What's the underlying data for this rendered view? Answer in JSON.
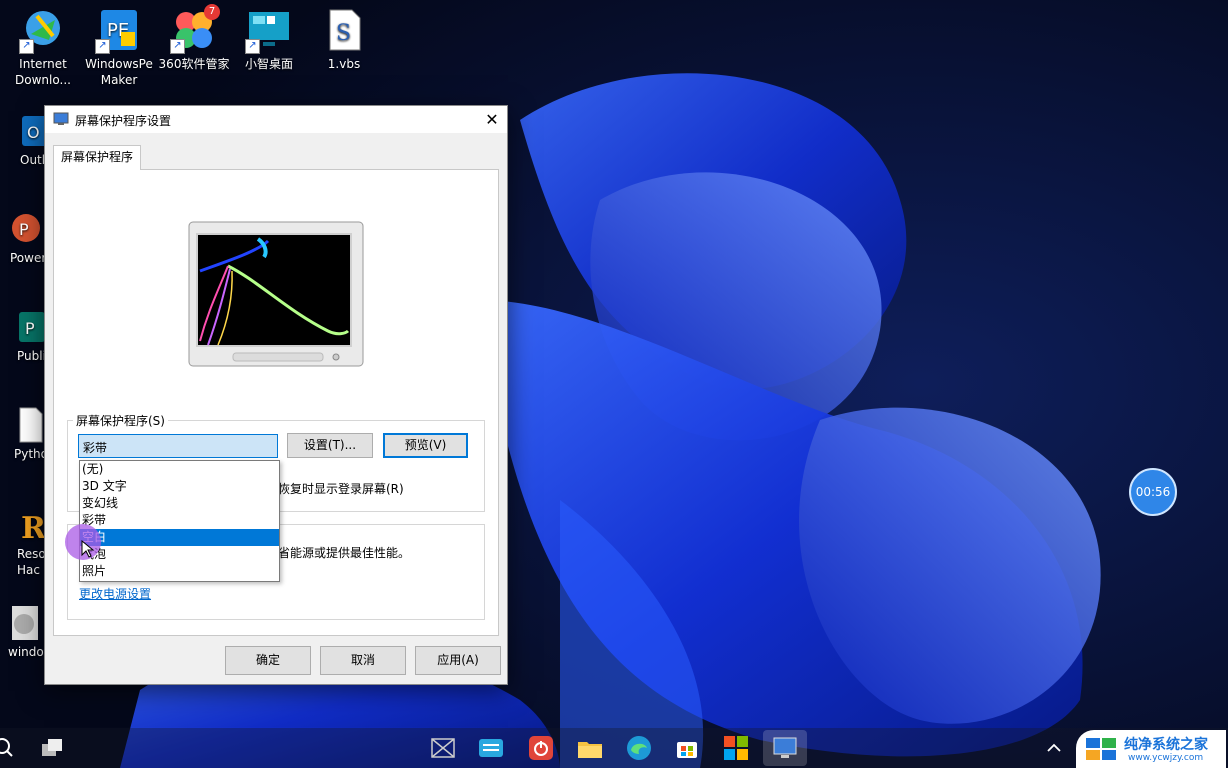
{
  "desktop": {
    "icons": [
      {
        "label": "Internet\nDownlo...",
        "name": "idm"
      },
      {
        "label": "WindowsPe\nMaker",
        "name": "windowspe-maker"
      },
      {
        "label": "360软件管家",
        "name": "360-software",
        "badge": "7"
      },
      {
        "label": "小智桌面",
        "name": "xiaozhi-desktop"
      },
      {
        "label": "1.vbs",
        "name": "vbs-file"
      },
      {
        "label": "Outl",
        "name": "outlook"
      },
      {
        "label": "Power",
        "name": "powerpoint"
      },
      {
        "label": "Publi",
        "name": "publisher"
      },
      {
        "label": "Pytho",
        "name": "python"
      },
      {
        "label": "Reso\nHac",
        "name": "resource-hacker"
      },
      {
        "label": "windo",
        "name": "windows-item"
      }
    ]
  },
  "dialog": {
    "title": "屏幕保护程序设置",
    "tab_label": "屏幕保护程序",
    "screensaver_group_label": "屏幕保护程序(S)",
    "combo_value": "彩带",
    "settings_button": "设置(T)...",
    "preview_button": "预览(V)",
    "options": [
      "(无)",
      "3D 文字",
      "变幻线",
      "彩带",
      "空白",
      "气泡",
      "照片"
    ],
    "selected_option_index": 4,
    "resume_text": "恢复时显示登录屏幕(R)",
    "power_text": "省能源或提供最佳性能。",
    "power_link": "更改电源设置",
    "ok_button": "确定",
    "cancel_button": "取消",
    "apply_button": "应用(A)"
  },
  "timer": "00:56",
  "watermark": {
    "title": "纯净系统之家",
    "subtitle": "www.ycwjzy.com"
  },
  "colors": {
    "accent": "#0078d7",
    "wallpaper_blue": "#1a3cff"
  }
}
